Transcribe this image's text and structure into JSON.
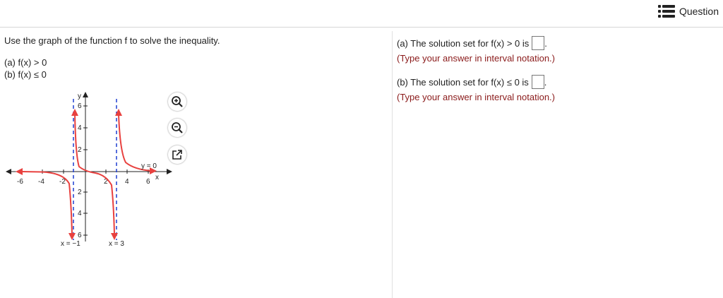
{
  "header": {
    "question_label": "Question"
  },
  "problem": {
    "prompt": "Use the graph of the function f to solve the inequality.",
    "part_a": "(a) f(x) > 0",
    "part_b": "(b) f(x) ≤ 0"
  },
  "answers": {
    "a_text": "(a) The solution set for f(x) > 0 is",
    "a_hint": "(Type your answer in interval notation.)",
    "b_text": "(b) The solution set for f(x) ≤ 0 is",
    "b_hint": "(Type your answer in interval notation.)",
    "period": "."
  },
  "tools": {
    "zoom_in": "zoom-in-icon",
    "zoom_out": "zoom-out-icon",
    "popout": "popout-icon"
  },
  "graph": {
    "x_ticks": [
      "-6",
      "-4",
      "-2",
      "2",
      "4",
      "6"
    ],
    "y_ticks_pos": [
      "6",
      "4",
      "2"
    ],
    "y_ticks_neg": [
      "2",
      "4",
      "6"
    ],
    "x_axis_label": "x",
    "y_axis_label": "y",
    "asymptote_left_label": "x = −1",
    "asymptote_right_label": "x = 3",
    "asymptote_h_label": "y = 0",
    "curve_color": "#e8413f",
    "asymptote_color": "#1f3fd1"
  }
}
